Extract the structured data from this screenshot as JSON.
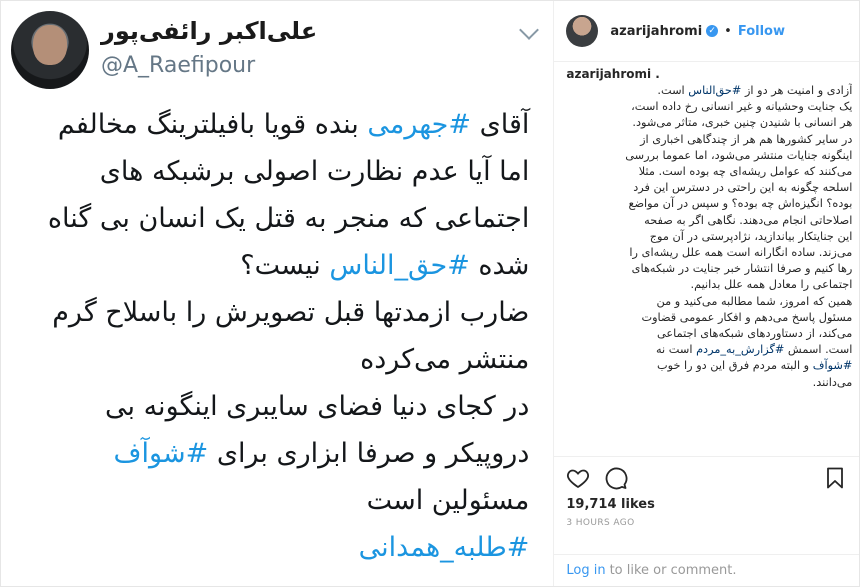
{
  "tweet": {
    "name": "علی‌اکبر رائفی‌پور",
    "handle": "@A_Raefipour",
    "lines": [
      [
        "آقای ",
        "#جهرمی",
        " بنده قویا بافیلترینگ مخالفم"
      ],
      [
        "اما آیا عدم نظارت اصولی برشبکه های",
        "",
        ""
      ],
      [
        "اجتماعی که منجر به قتل یک انسان بی گناه",
        "",
        ""
      ],
      [
        "شده ",
        "#حق_الناس",
        " نیست؟"
      ],
      [
        "ضارب ازمدتها قبل تصویرش را باسلاح گرم",
        "",
        ""
      ],
      [
        "منتشر می‌کرده",
        "",
        ""
      ],
      [
        "در کجای دنیا فضای سایبری اینگونه بی",
        "",
        ""
      ],
      [
        "دروپیکر و صرفا ابزاری برای ",
        "#شوآف",
        ""
      ],
      [
        "مسئولین است",
        "",
        ""
      ],
      [
        "",
        "#طلبه_همدانی",
        ""
      ]
    ]
  },
  "instagram": {
    "username": "azarijahromi",
    "verified_mark": "✓",
    "separator": "•",
    "follow_label": "Follow",
    "caption_user": "azarijahromi .",
    "caption_lines": [
      [
        "آزادی و امنیت هر دو از ",
        "#حق‌الناس",
        " است."
      ],
      [
        "یک جنایت وحشیانه و غیر انسانی رخ داده است،",
        "",
        ""
      ],
      [
        "هر انسانی با شنیدن چنین خبری، متاثر می‌شود.",
        "",
        ""
      ],
      [
        "در سایر کشورها هم هر از چندگاهی اخباری از",
        "",
        ""
      ],
      [
        "اینگونه جنایات منتشر می‌شود، اما عموما بررسی",
        "",
        ""
      ],
      [
        "می‌کنند که عوامل ریشه‌ای چه بوده است. مثلا",
        "",
        ""
      ],
      [
        "اسلحه چگونه به این راحتی در دسترس این فرد",
        "",
        ""
      ],
      [
        "بوده؟ انگیزه‌اش چه بوده؟ و سپس در آن مواضع",
        "",
        ""
      ],
      [
        "اصلاحاتی انجام می‌دهند. نگاهی اگر به صفحه",
        "",
        ""
      ],
      [
        "این جنایتکار بیاندازید، نژادپرستی در آن موج",
        "",
        ""
      ],
      [
        "می‌زند. ساده انگارانه است همه علل ریشه‌ای را",
        "",
        ""
      ],
      [
        "رها کنیم و صرفا انتشار خبر جنایت در شبکه‌های",
        "",
        ""
      ],
      [
        "اجتماعی را معادل همه علل بدانیم.",
        "",
        ""
      ],
      [
        "همین که امروز، شما مطالبه می‌کنید و من",
        "",
        ""
      ],
      [
        "مسئول پاسخ می‌دهم و افکار عمومی قضاوت",
        "",
        ""
      ],
      [
        "می‌کند، از دستاوردهای شبکه‌های اجتماعی",
        "",
        ""
      ],
      [
        "است. اسمش ",
        "#گزارش_به_مردم",
        " است نه"
      ],
      [
        "",
        "#شوآف",
        " و البته مردم فرق این دو را خوب"
      ],
      [
        "می‌دانند.",
        "",
        ""
      ]
    ],
    "likes": "19,714 likes",
    "time_ago": "3 HOURS AGO",
    "login_label": "Log in",
    "comment_prompt": "to like or comment."
  },
  "icons": [
    "heart-icon",
    "comment-icon",
    "share-icon",
    "bookmark-icon",
    "chevron-down-icon"
  ],
  "colors": {
    "accent": "#3897f0",
    "hashtag_tweet": "#1b95e0",
    "hashtag_caption": "#003569"
  }
}
